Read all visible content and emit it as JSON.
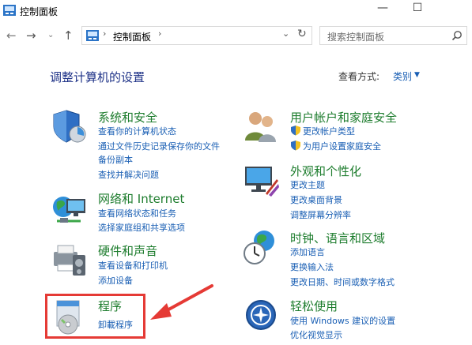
{
  "window": {
    "title": "控制面板",
    "minimize": "—",
    "maximize": "☐"
  },
  "address": {
    "breadcrumb": "控制面板",
    "search_placeholder": "搜索控制面板"
  },
  "header": {
    "title": "调整计算机的设置",
    "view_by_label": "查看方式:",
    "view_by_value": "类别"
  },
  "categories": [
    {
      "title": "系统和安全",
      "links": [
        "查看你的计算机状态",
        "通过文件历史记录保存你的文件",
        "备份副本",
        "查找并解决问题"
      ]
    },
    {
      "title": "网络和 Internet",
      "links": [
        "查看网络状态和任务",
        "选择家庭组和共享选项"
      ]
    },
    {
      "title": "硬件和声音",
      "links": [
        "查看设备和打印机",
        "添加设备"
      ]
    },
    {
      "title": "程序",
      "links": [
        "卸載程序"
      ]
    },
    {
      "title": "用户帐户和家庭安全",
      "links": [
        "更改帐户类型",
        "为用户设置家庭安全"
      ]
    },
    {
      "title": "外观和个性化",
      "links": [
        "更改主题",
        "更改桌面背景",
        "调整屏幕分辨率"
      ]
    },
    {
      "title": "时钟、语言和区域",
      "links": [
        "添加语言",
        "更换输入法",
        "更改日期、时间或数字格式"
      ]
    },
    {
      "title": "轻松使用",
      "links": [
        "使用 Windows 建议的设置",
        "优化视觉显示"
      ]
    }
  ],
  "colors": {
    "link": "#1a5fb4",
    "category_title": "#1e7d2e",
    "page_title": "#1e3287",
    "highlight": "#e53a35"
  }
}
